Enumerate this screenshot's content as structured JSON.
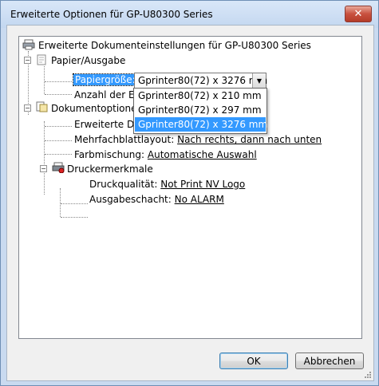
{
  "window": {
    "title": "Erweiterte Optionen für GP-U80300 Series"
  },
  "tree": {
    "root_label": "Erweiterte Dokumenteinstellungen für GP-U80300 Series",
    "paper_section": "Papier/Ausgabe",
    "paper_size_label": "Papiergröße:",
    "copies_label": "Anzahl der Exe",
    "doc_options": "Dokumentoptione",
    "advanced_printing": "Erweiterte Dru",
    "multipage_label": "Mehrfachblattlayout:",
    "multipage_value": "Nach rechts, dann nach unten",
    "color_label": "Farbmischung:",
    "color_value": "Automatische Auswahl",
    "printer_features": "Druckermerkmale",
    "quality_label": "Druckqualität:",
    "quality_value": "Not Print NV Logo",
    "output_label": "Ausgabeschacht:",
    "output_value": "No ALARM"
  },
  "paper_size_combo": {
    "value": "Gprinter80(72) x 3276 mm",
    "options": [
      "Gprinter80(72) x 210 mm",
      "Gprinter80(72) x 297 mm",
      "Gprinter80(72) x 3276 mm"
    ],
    "selected_index": 2
  },
  "buttons": {
    "ok": "OK",
    "cancel": "Abbrechen",
    "close": "✕"
  },
  "icons": {
    "close": "close-icon",
    "printer": "printer-icon",
    "paper": "paper-icon",
    "document": "document-options-icon",
    "printer_features": "printer-features-icon"
  }
}
